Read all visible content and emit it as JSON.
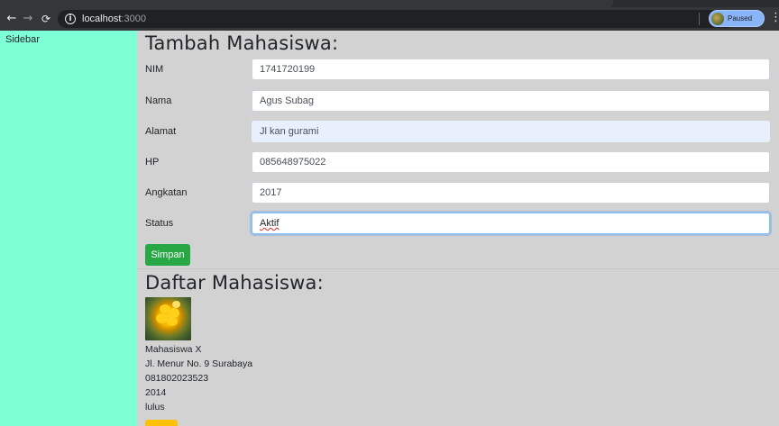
{
  "browser": {
    "url_host": "localhost",
    "url_port": ":3000",
    "profile_status": "Paused",
    "icons": {
      "back": "arrow-left-icon",
      "forward": "arrow-right-icon",
      "reload": "reload-icon",
      "info": "info-icon",
      "bookmark": "star-icon",
      "extension": "extension-icon",
      "menu": "kebab-menu-icon"
    }
  },
  "sidebar": {
    "label": "Sidebar"
  },
  "form": {
    "title": "Tambah Mahasiswa:",
    "fields": [
      {
        "label": "NIM",
        "value": "1741720199"
      },
      {
        "label": "Nama",
        "value": "Agus Subag"
      },
      {
        "label": "Alamat",
        "value": "Jl kan gurami"
      },
      {
        "label": "HP",
        "value": "085648975022"
      },
      {
        "label": "Angkatan",
        "value": "2017"
      },
      {
        "label": "Status",
        "value": "Aktif"
      }
    ],
    "submit_label": "Simpan"
  },
  "list": {
    "title": "Daftar Mahasiswa:",
    "items": [
      {
        "photo": "yellow-flower-photo",
        "nama": "Mahasiswa X",
        "alamat": "Jl. Menur No. 9 Surabaya",
        "hp": "081802023523",
        "angkatan": "2014",
        "status": "lulus"
      }
    ]
  },
  "colors": {
    "sidebar_bg": "#7fffd4",
    "page_bg": "#d2d2d2",
    "submit_button": "#28a745",
    "item_button": "#ffc107",
    "focus_ring": "#80bdff"
  }
}
